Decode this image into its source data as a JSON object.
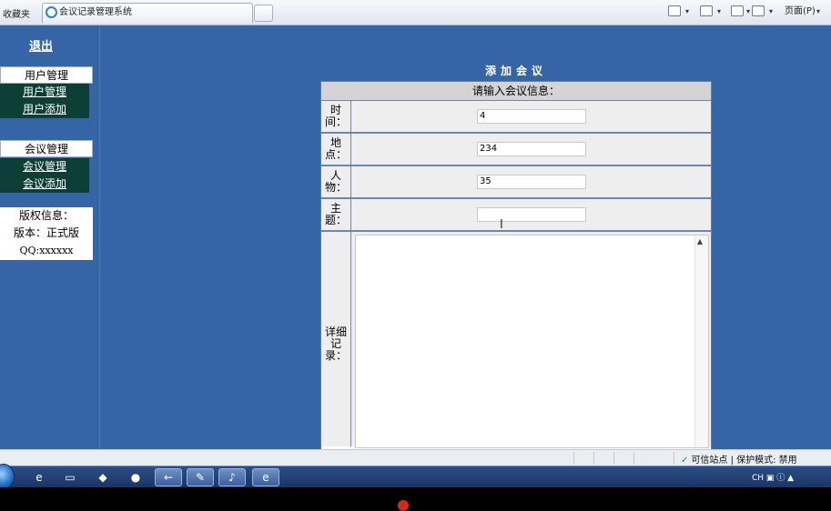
{
  "browser": {
    "favorites_label": "收藏夹",
    "tab_title": "会议记录管理系统",
    "page_menu": "页面(P)",
    "caret": "▾"
  },
  "sidebar": {
    "logout": "退出",
    "user_group": {
      "heading": "用户管理",
      "items": [
        "用户管理",
        "用户添加"
      ]
    },
    "meeting_group": {
      "heading": "会议管理",
      "items": [
        "会议管理",
        "会议添加"
      ]
    },
    "info": {
      "line1": "版权信息：",
      "line2": "版本：正式版",
      "line3": "QQ:xxxxxx"
    }
  },
  "form": {
    "title": "添加会议",
    "header": "请输入会议信息：",
    "fields": [
      {
        "label": "时间：",
        "value": "4"
      },
      {
        "label": "地点：",
        "value": "234"
      },
      {
        "label": "人物：",
        "value": "35"
      },
      {
        "label": "主题：",
        "value": ""
      }
    ],
    "details_label": "详细记录：",
    "details_value": ""
  },
  "status_bar": {
    "zone": "可信站点 | 保护模式: 禁用"
  },
  "taskbar": {
    "tray_text": "CH"
  }
}
